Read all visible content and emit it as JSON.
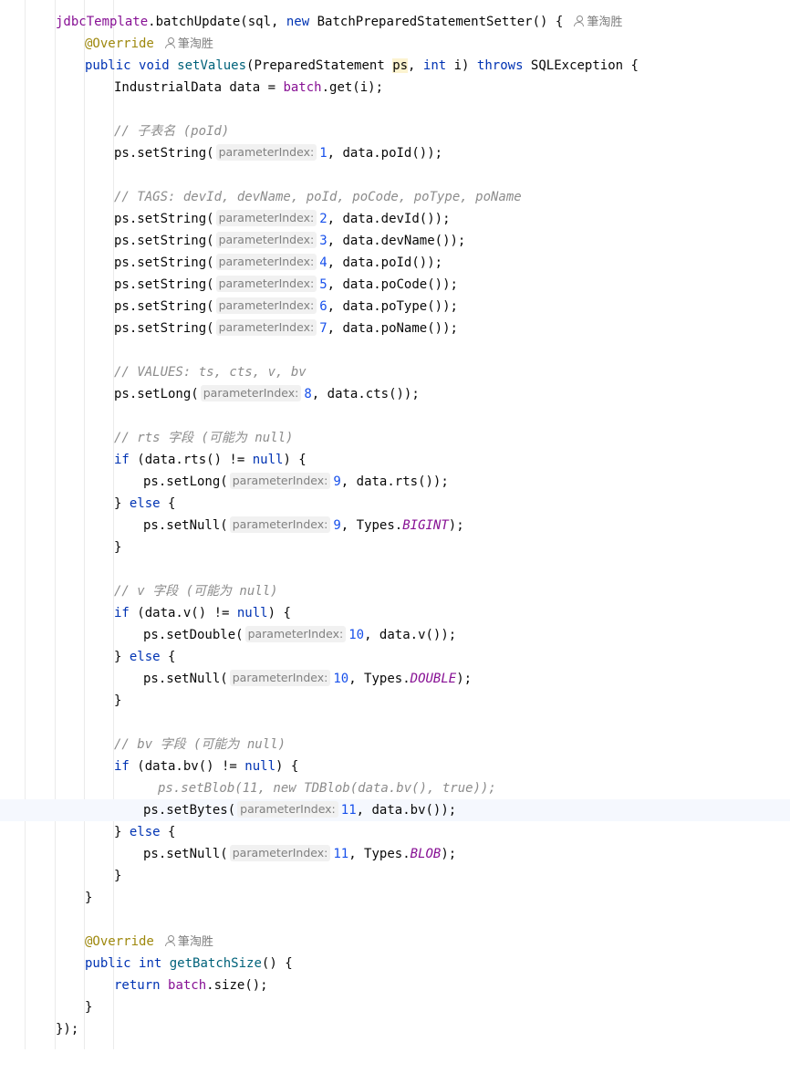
{
  "author": "筆淘胜",
  "code": {
    "l1_obj": "jdbcTemplate",
    "l1_dot": ".batchUpdate(sql, ",
    "l1_new": "new",
    "l1_rest": " BatchPreparedStatementSetter() {",
    "override": "@Override",
    "l3_public": "public",
    "l3_void": "void",
    "l3_method": "setValues",
    "l3_a": "(PreparedStatement ",
    "l3_ps": "ps",
    "l3_comma": ", ",
    "l3_int": "int",
    "l3_i": " i) ",
    "l3_throws": "throws",
    "l3_exc": " SQLException {",
    "l4_a": "IndustrialData data = ",
    "l4_batch": "batch",
    "l4_b": ".get(i);",
    "c_poid": "// 子表名 (poId)",
    "c_tags": "// TAGS: devId, devName, poId, poCode, poType, poName",
    "c_values": "// VALUES: ts, cts, v, bv",
    "c_rts": "// rts 字段 (可能为 null)",
    "c_v": "// v 字段 (可能为 null)",
    "c_bv": "// bv 字段 (可能为 null)",
    "setString": "ps.setString(",
    "setLong": "ps.setLong(",
    "setNull": "ps.setNull(",
    "setDouble": "ps.setDouble(",
    "setBytes": "ps.setBytes(",
    "hint": "parameterIndex:",
    "if": "if",
    "else": "else",
    "null": "null",
    "types": ", Types.",
    "bigint": "BIGINT",
    "double": "DOUBLE",
    "blob": "BLOB",
    "end_paren": ");",
    "close_brace": "}",
    "else_open": " {",
    "p1": "1",
    "p2": "2",
    "p3": "3",
    "p4": "4",
    "p5": "5",
    "p6": "6",
    "p7": "7",
    "p8": "8",
    "p9": "9",
    "p10": "10",
    "p11": "11",
    "arg_poid1": ", data.poId());",
    "arg_devid": ", data.devId());",
    "arg_devname": ", data.devName());",
    "arg_poid2": ", data.poId());",
    "arg_pocode": ", data.poCode());",
    "arg_potype": ", data.poType());",
    "arg_poname": ", data.poName());",
    "arg_cts": ", data.cts());",
    "arg_rts": ", data.rts());",
    "arg_v": ", data.v());",
    "arg_bv": ", data.bv());",
    "if_rts_a": " (data.rts() != ",
    "if_v_a": " (data.v() != ",
    "if_bv_a": " (data.bv() != ",
    "if_end": ") {",
    "blob_comment": "ps.setBlob(11, new TDBlob(data.bv(), true));",
    "public": "public",
    "int": "int",
    "getBatchSize": "getBatchSize",
    "gbs_rest": "() {",
    "return": "return",
    "batch": "batch",
    "size": ".size();",
    "end": "});"
  }
}
